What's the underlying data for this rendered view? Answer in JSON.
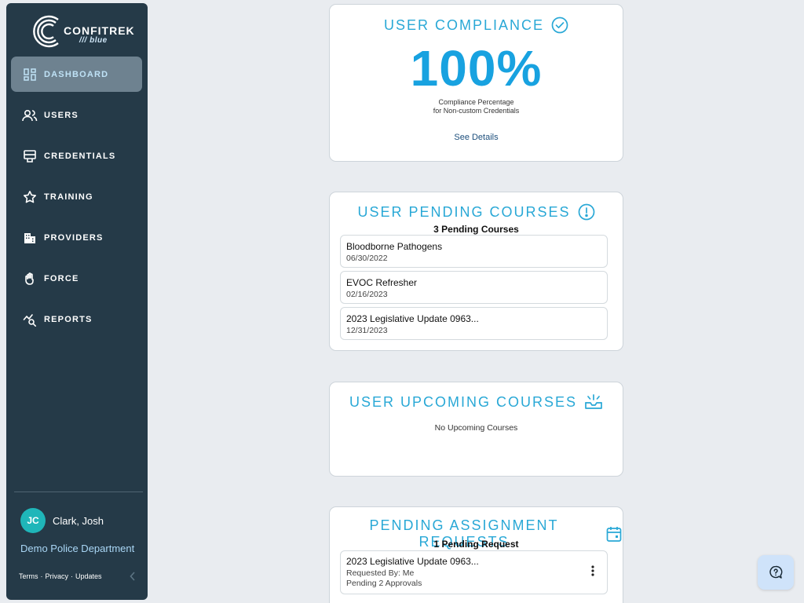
{
  "brand": {
    "name": "CONFITREK",
    "sub": "/// blue"
  },
  "nav": [
    {
      "label": "DASHBOARD",
      "icon": "dashboard-icon",
      "active": true
    },
    {
      "label": "USERS",
      "icon": "users-icon"
    },
    {
      "label": "CREDENTIALS",
      "icon": "credentials-icon"
    },
    {
      "label": "TRAINING",
      "icon": "star-icon"
    },
    {
      "label": "PROVIDERS",
      "icon": "building-icon"
    },
    {
      "label": "FORCE",
      "icon": "hand-icon"
    },
    {
      "label": "REPORTS",
      "icon": "reports-icon"
    }
  ],
  "user": {
    "initials": "JC",
    "name": "Clark, Josh",
    "org": "Demo Police Department"
  },
  "footer": {
    "terms": "Terms",
    "privacy": "Privacy",
    "updates": "Updates",
    "sep": "·"
  },
  "compliance": {
    "title": "USER COMPLIANCE",
    "value": "100%",
    "caption_line1": "Compliance Percentage",
    "caption_line2": "for Non-custom Credentials",
    "link": "See Details"
  },
  "pending_courses": {
    "title": "USER PENDING COURSES",
    "count_label": "3 Pending Courses",
    "items": [
      {
        "name": "Bloodborne Pathogens",
        "date": "06/30/2022"
      },
      {
        "name": "EVOC Refresher",
        "date": "02/16/2023"
      },
      {
        "name": "2023 Legislative Update 0963...",
        "date": "12/31/2023"
      }
    ]
  },
  "upcoming_courses": {
    "title": "USER UPCOMING COURSES",
    "empty": "No Upcoming Courses"
  },
  "assignment_requests": {
    "title": "PENDING ASSIGNMENT REQUESTS",
    "count_label": "1 Pending Request",
    "items": [
      {
        "name": "2023 Legislative Update 0963...",
        "requested_by": "Requested By: Me",
        "status": "Pending 2 Approvals"
      }
    ]
  },
  "colors": {
    "accent": "#29a8d6",
    "sidebar": "#253a48",
    "avatar": "#1fb6b9",
    "link": "#1d4f7c"
  }
}
